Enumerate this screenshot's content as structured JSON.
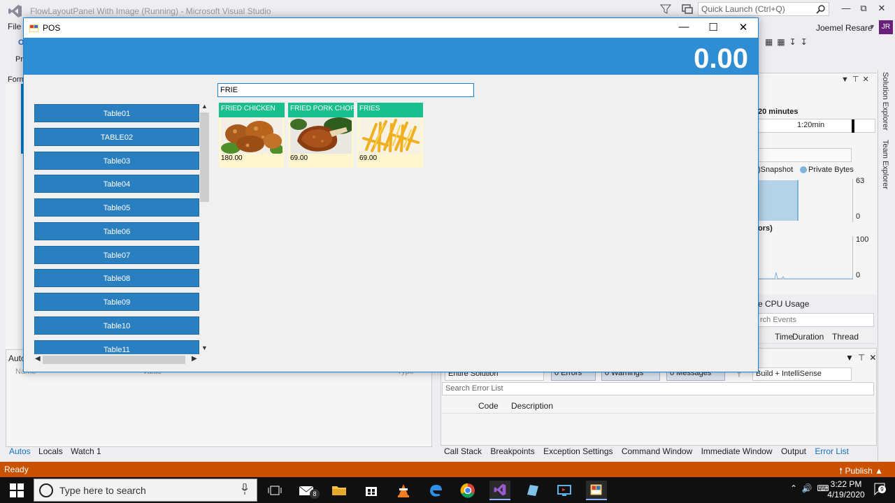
{
  "vs": {
    "title": "FlowLayoutPanel With Image (Running) - Microsoft Visual Studio",
    "quick_launch_placeholder": "Quick Launch (Ctrl+Q)",
    "menu_file": "File",
    "user_name": "Joemel Resare",
    "user_initials": "JR",
    "left_strip_a": "O",
    "left_strip_b": "Pr",
    "left_strip_c": "Form",
    "diagnostics": {
      "minutes": "20 minutes",
      "timeline_label": "1:20min",
      "legend_snapshot": ")Snapshot",
      "legend_private": "Private Bytes",
      "y_top_1": "63",
      "y_bottom_1": "0",
      "section2": "ors)",
      "y_top_2": "100",
      "y_bottom_2": "0",
      "cpu_tab": "e  CPU Usage",
      "search_events": "rch Events",
      "col_time": "Time",
      "col_duration": "Duration",
      "col_thread": "Thread"
    },
    "rail_solution": "Solution Explorer",
    "rail_team": "Team Explorer",
    "autos": {
      "title": "Auto",
      "col_name": "Name",
      "col_value": "Value",
      "col_type": "Type",
      "tabs": [
        "Autos",
        "Locals",
        "Watch 1"
      ]
    },
    "errors": {
      "scope": "Entire Solution",
      "errors_btn": "0 Errors",
      "warnings_btn": "0 Warnings",
      "messages_btn": "0 Messages",
      "build": "Build + IntelliSense",
      "search_placeholder": "Search Error List",
      "col_code": "Code",
      "col_description": "Description",
      "tabs": [
        "Call Stack",
        "Breakpoints",
        "Exception Settings",
        "Command Window",
        "Immediate Window",
        "Output",
        "Error List"
      ]
    },
    "status_ready": "Ready",
    "status_publish": "Publish"
  },
  "taskbar": {
    "search_placeholder": "Type here to search",
    "mail_badge": "8",
    "time": "3:22 PM",
    "date": "4/19/2020",
    "notif_count": "9"
  },
  "pos": {
    "title": "POS",
    "total": "0.00",
    "search_value": "FRIE",
    "tables": [
      "Table01",
      "TABLE02",
      "Table03",
      "Table04",
      "Table05",
      "Table06",
      "Table07",
      "Table08",
      "Table09",
      "Table10",
      "Table11"
    ],
    "products": [
      {
        "name": "FRIED CHICKEN",
        "price": "180.00"
      },
      {
        "name": "FRIED PORK CHOP",
        "price": "69.00"
      },
      {
        "name": "FRIES",
        "price": "69.00"
      }
    ],
    "colors": {
      "header": "#2f8dd4",
      "table_button": "#2a7fc1",
      "product_title": "#19bf8c",
      "product_bg": "#fdf6cf"
    }
  }
}
